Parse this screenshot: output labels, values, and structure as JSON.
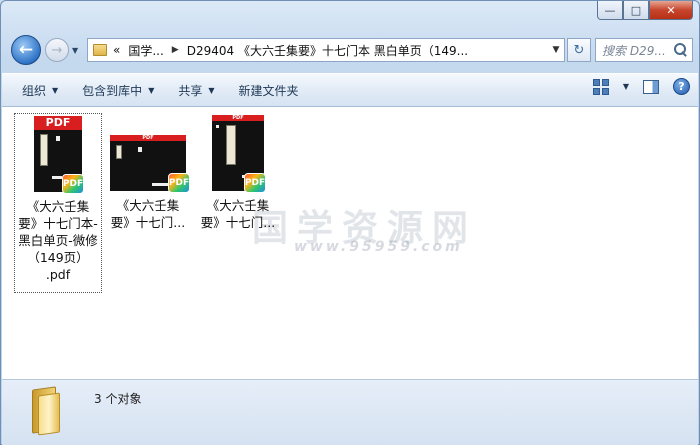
{
  "window": {
    "minimize_label": "—",
    "maximize_label": "□",
    "close_label": "✕"
  },
  "nav": {
    "back_glyph": "←",
    "forward_glyph": "→",
    "history_glyph": "▼",
    "address_prefix": "«",
    "crumb_1": "国学...",
    "crumb_2": "D29404 《大六壬集要》十七门本 黑白单页（149...",
    "sep_glyph": "▶",
    "addr_dropdown_glyph": "▼",
    "refresh_glyph": "↻",
    "search_placeholder": "搜索 D29..."
  },
  "toolbar": {
    "organize": "组织",
    "include_in_library": "包含到库中",
    "share": "共享",
    "new_folder": "新建文件夹",
    "caret": "▼",
    "help_glyph": "?"
  },
  "watermark": {
    "text": "国学资源网",
    "url": "www.95959.com"
  },
  "files": [
    {
      "name": "《大六壬集要》十七门本-黑白单页-微修（149页）.pdf",
      "line1": "《大六壬集",
      "line2": "要》十七门本-",
      "line3": "黑白单页-微修",
      "line4": "（149页）",
      "line5": ".pdf",
      "selected": true,
      "pdf_header": "PDF",
      "badge": "PDF"
    },
    {
      "name": "《大六壬集要》十七门...",
      "line1": "《大六壬集",
      "line2": "要》十七门...",
      "selected": false,
      "pdf_header": "PDF",
      "badge": "PDF"
    },
    {
      "name": "《大六壬集要》十七门...",
      "line1": "《大六壬集",
      "line2": "要》十七门...",
      "selected": false,
      "pdf_header": "PDF",
      "badge": "PDF"
    }
  ],
  "status": {
    "count_text": "3 个对象"
  },
  "colors": {
    "pdf_red": "#d81e1e",
    "window_blue": "#c4d8ee",
    "close_red": "#c7452c"
  }
}
